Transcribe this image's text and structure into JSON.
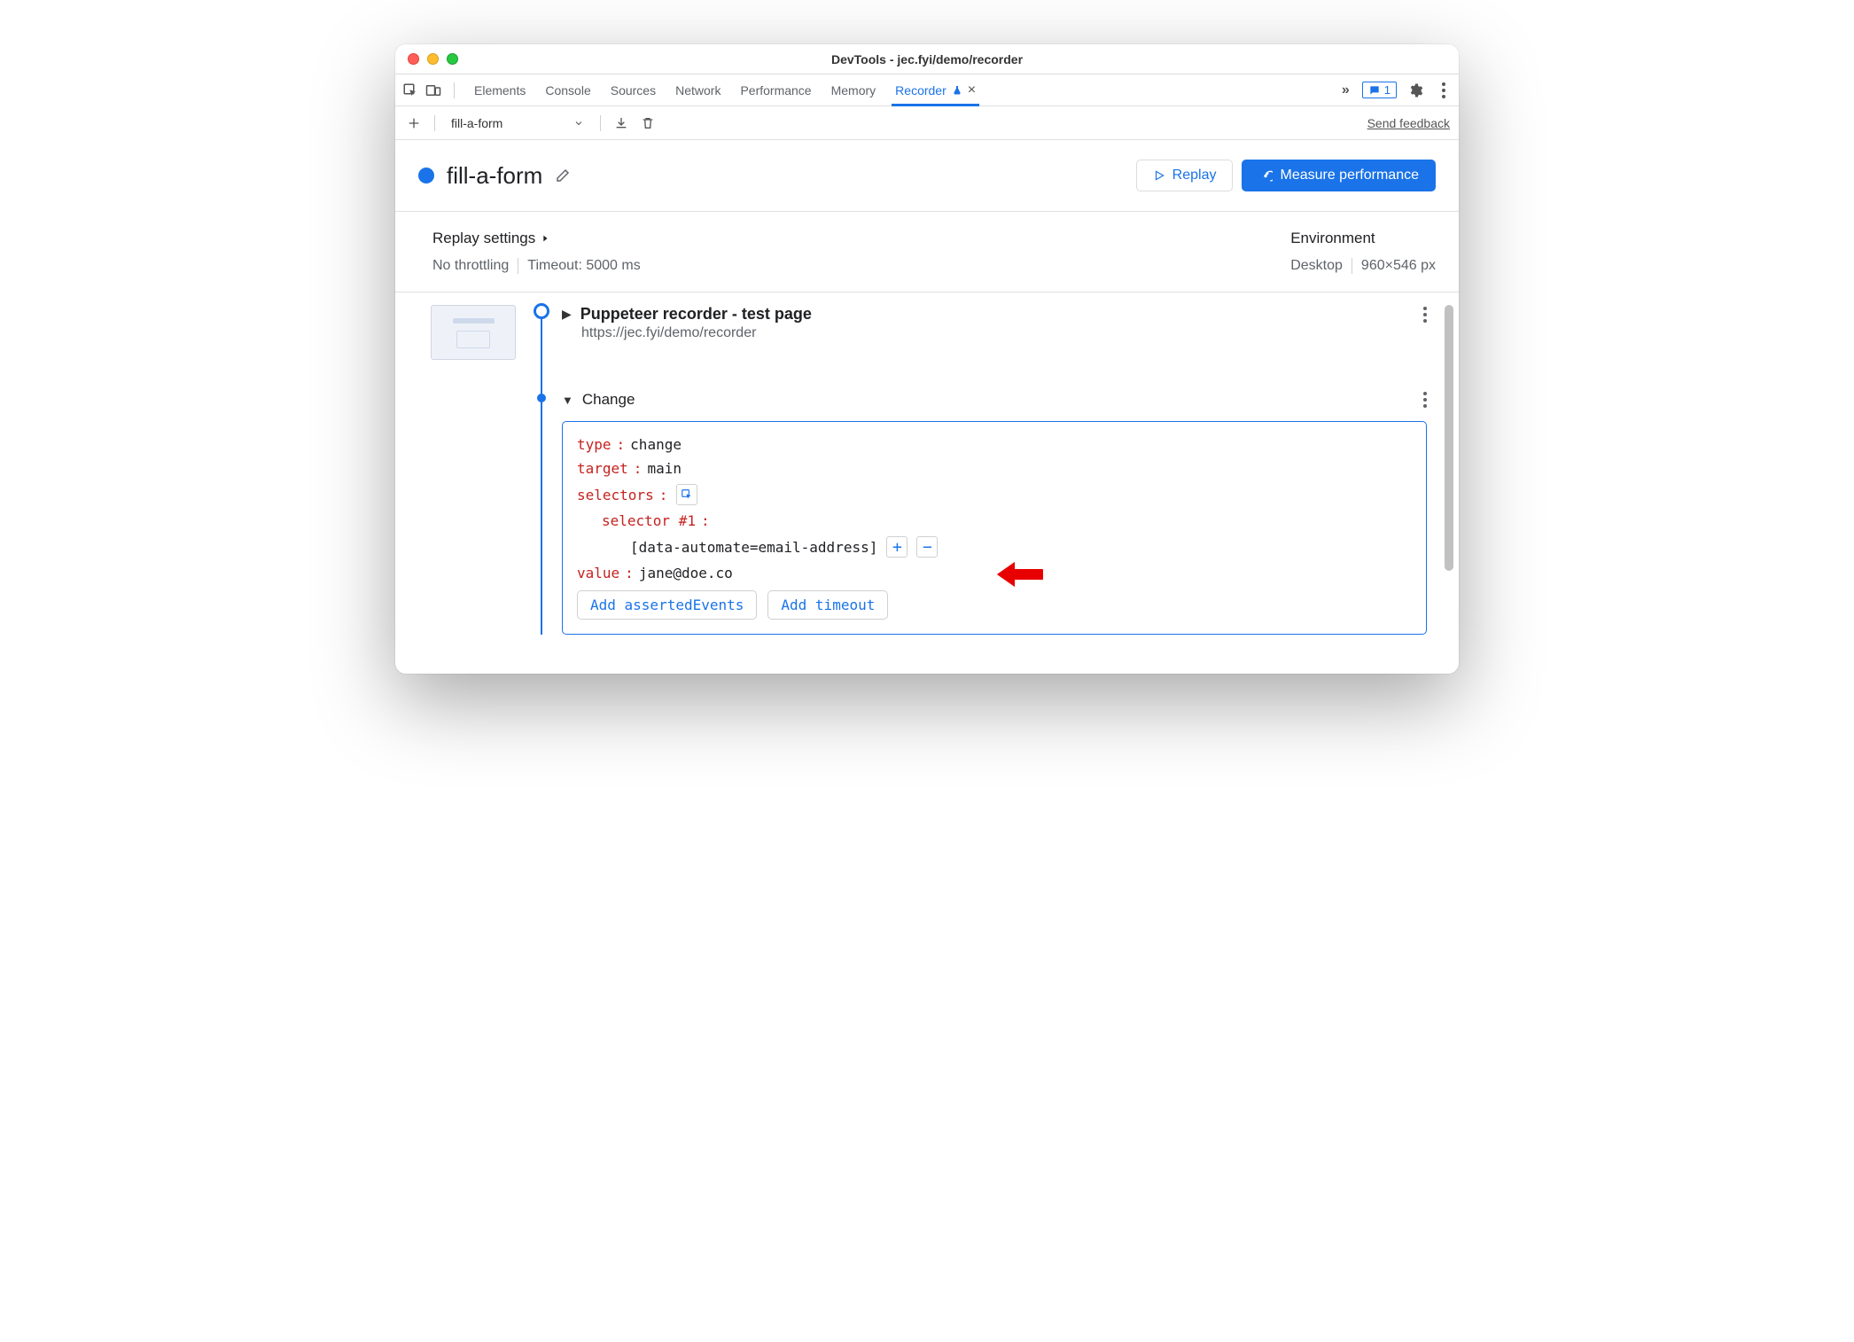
{
  "window": {
    "title": "DevTools - jec.fyi/demo/recorder"
  },
  "tabs": {
    "items": [
      "Elements",
      "Console",
      "Sources",
      "Network",
      "Performance",
      "Memory",
      "Recorder"
    ],
    "active": "Recorder",
    "message_count": "1"
  },
  "toolbar": {
    "dropdown_value": "fill-a-form",
    "send_feedback": "Send feedback"
  },
  "recorder_header": {
    "name": "fill-a-form",
    "replay_button": "Replay",
    "measure_button": "Measure performance"
  },
  "settings": {
    "replay_heading": "Replay settings",
    "throttle": "No throttling",
    "timeout": "Timeout: 5000 ms",
    "env_heading": "Environment",
    "device": "Desktop",
    "dimensions": "960×546 px"
  },
  "steps": {
    "first": {
      "title": "Puppeteer recorder - test page",
      "url": "https://jec.fyi/demo/recorder"
    },
    "change": {
      "title": "Change",
      "type_key": "type",
      "type_val": "change",
      "target_key": "target",
      "target_val": "main",
      "selectors_key": "selectors",
      "selector_label": "selector #1",
      "selector_val": "[data-automate=email-address]",
      "value_key": "value",
      "value_val": "jane@doe.co",
      "add_asserted": "Add assertedEvents",
      "add_timeout": "Add timeout"
    }
  }
}
